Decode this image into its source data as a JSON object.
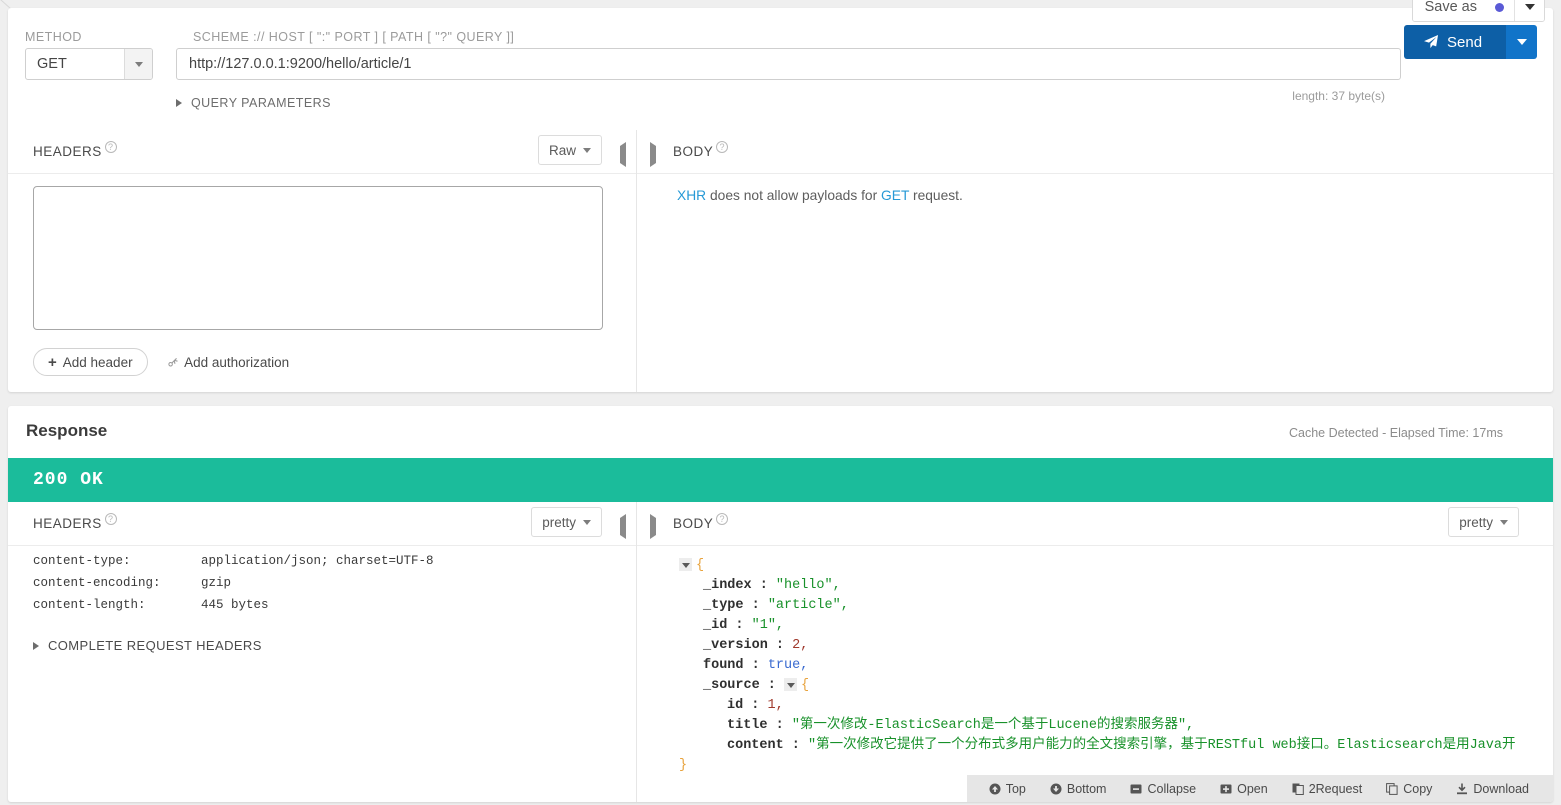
{
  "topbar": {
    "save_as_label": "Save as"
  },
  "request": {
    "method_label": "METHOD",
    "method_value": "GET",
    "url_label": "SCHEME :// HOST [ \":\" PORT ] [ PATH [ \"?\" QUERY ]]",
    "url_value": "http://127.0.0.1:9200/hello/article/1",
    "send_label": "Send",
    "length_note": "length: 37 byte(s)",
    "query_parameters_label": "QUERY PARAMETERS",
    "headers": {
      "title": "HEADERS",
      "mode": "Raw",
      "textarea_value": "",
      "add_header_label": "Add header",
      "add_authorization_label": "Add authorization"
    },
    "body": {
      "title": "BODY",
      "note_prefix": "XHR",
      "note_middle": " does not allow payloads for ",
      "note_method": "GET",
      "note_suffix": " request."
    }
  },
  "response": {
    "title": "Response",
    "meta": "Cache Detected - Elapsed Time: 17ms",
    "status": "200 OK",
    "status_color": "#1bbc9b",
    "headers": {
      "title": "HEADERS",
      "mode": "pretty",
      "rows": [
        {
          "key": "content-type:",
          "value": "application/json; charset=UTF-8"
        },
        {
          "key": "content-encoding:",
          "value": "gzip"
        },
        {
          "key": "content-length:",
          "value": "445 bytes"
        }
      ],
      "complete_request_headers_label": "COMPLETE REQUEST HEADERS"
    },
    "body": {
      "title": "BODY",
      "mode": "pretty",
      "json": {
        "open_brace": "{",
        "lines": [
          {
            "key": "_index :",
            "value": "\"hello\",",
            "type": "string",
            "indent": 1
          },
          {
            "key": "_type :",
            "value": "\"article\",",
            "type": "string",
            "indent": 1
          },
          {
            "key": "_id :",
            "value": "\"1\",",
            "type": "string",
            "indent": 1
          },
          {
            "key": "_version :",
            "value": "2,",
            "type": "number",
            "indent": 1
          },
          {
            "key": "found :",
            "value": "true,",
            "type": "bool",
            "indent": 1
          },
          {
            "key": "_source :",
            "value": "{",
            "type": "object",
            "indent": 1
          },
          {
            "key": "id :",
            "value": "1,",
            "type": "number",
            "indent": 2
          },
          {
            "key": "title :",
            "value": "\"第一次修改-ElasticSearch是一个基于Lucene的搜索服务器\",",
            "type": "string",
            "indent": 2
          },
          {
            "key": "content :",
            "value": "\"第一次修改它提供了一个分布式多用户能力的全文搜索引擎，基于RESTful web接口。Elasticsearch是用Java开",
            "type": "string",
            "indent": 2
          }
        ],
        "close_brace": "}"
      }
    },
    "toolbar": [
      {
        "icon": "arrow-up-circle-icon",
        "glyph": "●",
        "label": "Top"
      },
      {
        "icon": "arrow-down-circle-icon",
        "glyph": "●",
        "label": "Bottom"
      },
      {
        "icon": "minus-square-icon",
        "glyph": "■",
        "label": "Collapse"
      },
      {
        "icon": "plus-square-icon",
        "glyph": "■",
        "label": "Open"
      },
      {
        "icon": "copy-page-icon",
        "glyph": "❐",
        "label": "2Request"
      },
      {
        "icon": "copy-icon",
        "glyph": "❐",
        "label": "Copy"
      },
      {
        "icon": "download-icon",
        "glyph": "⤓",
        "label": "Download"
      }
    ]
  }
}
